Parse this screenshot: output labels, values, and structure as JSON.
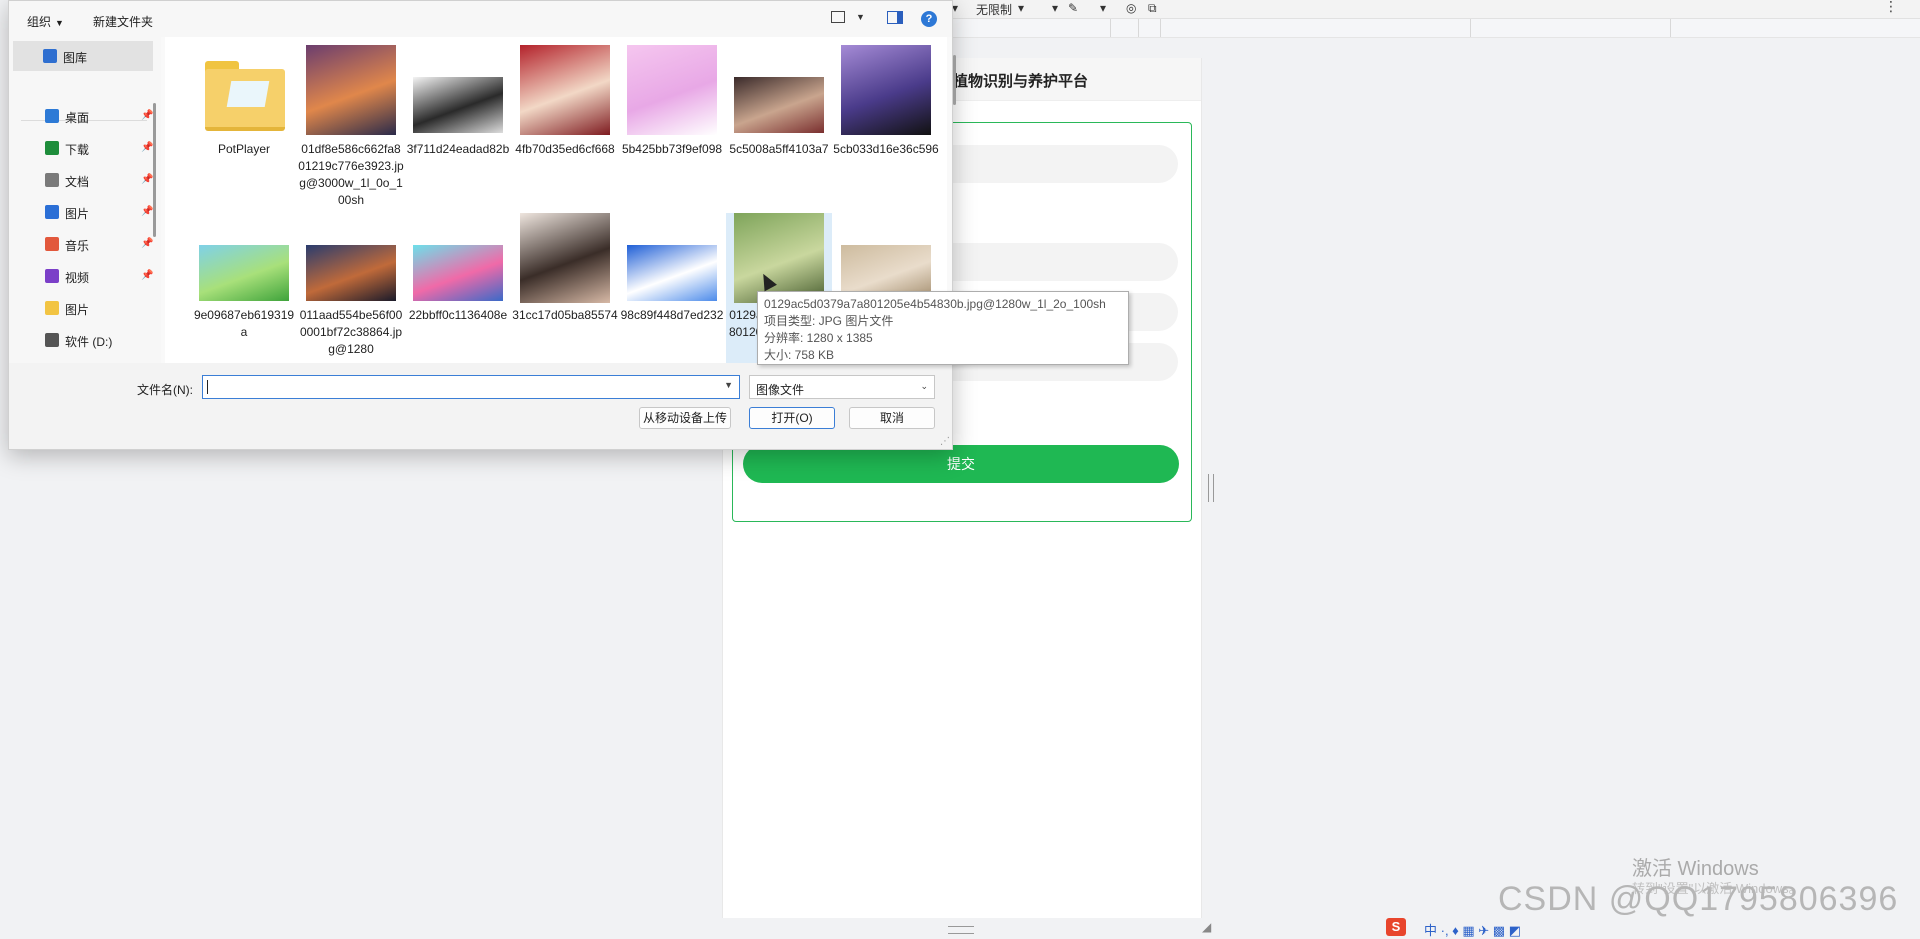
{
  "bg_toolbar": {
    "limit_label": "无限制",
    "more": "⋮"
  },
  "app": {
    "title": "植物识别与养护平台",
    "submit_label": "提交"
  },
  "watermark": {
    "activate_title": "激活 Windows",
    "activate_sub": "转到\"设置\"以激活 Windows。",
    "csdn": "CSDN @QQ1795806396"
  },
  "tray": {
    "s_label": "S",
    "glyphs": "中 ·, ♦ ▦ ✈ ▩ ◩"
  },
  "dialog": {
    "toolbar": {
      "organize": "组织",
      "new_folder": "新建文件夹",
      "help": "?"
    },
    "nav": [
      {
        "label": "图库",
        "icon": "gallery-icon",
        "color": "#2f6fd0",
        "selected": true,
        "pinned": false
      },
      {
        "label": "桌面",
        "icon": "desktop-icon",
        "color": "#2d7ad6",
        "selected": false,
        "pinned": true
      },
      {
        "label": "下载",
        "icon": "download-icon",
        "color": "#1e8d3b",
        "selected": false,
        "pinned": true
      },
      {
        "label": "文档",
        "icon": "document-icon",
        "color": "#7a7a7a",
        "selected": false,
        "pinned": true
      },
      {
        "label": "图片",
        "icon": "pictures-icon",
        "color": "#2b6fd6",
        "selected": false,
        "pinned": true
      },
      {
        "label": "音乐",
        "icon": "music-icon",
        "color": "#e2583c",
        "selected": false,
        "pinned": true
      },
      {
        "label": "视频",
        "icon": "video-icon",
        "color": "#7b3fc8",
        "selected": false,
        "pinned": true
      },
      {
        "label": "图片",
        "icon": "folder-icon",
        "color": "#f2c443",
        "selected": false,
        "pinned": false
      },
      {
        "label": "软件 (D:)",
        "icon": "drive-icon",
        "color": "#555555",
        "selected": false,
        "pinned": false
      }
    ],
    "files": [
      {
        "name": "PotPlayer",
        "kind": "folder"
      },
      {
        "name": "01df8e586c662fa801219c776e3923.jpg@3000w_1l_0o_100sh",
        "kind": "image",
        "colors": [
          "#6b3d6e",
          "#e0874b",
          "#2a2a4a"
        ]
      },
      {
        "name": "3f711d24eadad82b",
        "kind": "image",
        "colors": [
          "#f4f4f4",
          "#2a2a2a",
          "#dddddd"
        ]
      },
      {
        "name": "4fb70d35ed6cf668",
        "kind": "image",
        "colors": [
          "#b3222b",
          "#f2d8c6",
          "#7e1b20"
        ]
      },
      {
        "name": "5b425bb73f9ef098",
        "kind": "image",
        "colors": [
          "#f5c6ef",
          "#e8a8e6",
          "#ffffff"
        ]
      },
      {
        "name": "5c5008a5ff4103a7",
        "kind": "image",
        "colors": [
          "#3a2a2a",
          "#c9a58e",
          "#7a2f2f"
        ]
      },
      {
        "name": "5cb033d16e36c596",
        "kind": "image",
        "colors": [
          "#a58bd6",
          "#4a3b8a",
          "#111111"
        ]
      },
      {
        "name": "9e09687eb619319a",
        "kind": "image",
        "colors": [
          "#7fd1e8",
          "#a8e07a",
          "#3fa33b"
        ]
      },
      {
        "name": "011aad554be56f000001bf72c38864.jpg@1280",
        "kind": "image",
        "colors": [
          "#2a3c6e",
          "#c06a3a",
          "#1a1a2a"
        ]
      },
      {
        "name": "22bbff0c1136408e",
        "kind": "image",
        "colors": [
          "#6de0ea",
          "#f06aa8",
          "#3a6ac8"
        ]
      },
      {
        "name": "31cc17d05ba85574",
        "kind": "image",
        "colors": [
          "#efe6df",
          "#3a2d28",
          "#d7b9a6"
        ]
      },
      {
        "name": "98c89f448d7ed232",
        "kind": "image",
        "colors": [
          "#1f5fd6",
          "#ffffff",
          "#4c8bea"
        ]
      },
      {
        "name": "0129ac5d0379a7a801205e4b54830b",
        "kind": "image",
        "colors": [
          "#7ea45a",
          "#c9d79e",
          "#445a2c"
        ]
      },
      {
        "name": "",
        "kind": "image",
        "colors": [
          "#cdbb9e",
          "#e9dccb",
          "#a08a6a"
        ]
      }
    ],
    "tooltip": {
      "line1": "0129ac5d0379a7a801205e4b54830b.jpg@1280w_1l_2o_100sh",
      "line2": "项目类型: JPG 图片文件",
      "line3": "分辨率: 1280 x 1385",
      "line4": "大小: 758 KB"
    },
    "filename_label": "文件名(N):",
    "filename_value": "",
    "filetype_value": "图像文件",
    "upload_label": "从移动设备上传",
    "open_label": "打开(O)",
    "cancel_label": "取消"
  }
}
